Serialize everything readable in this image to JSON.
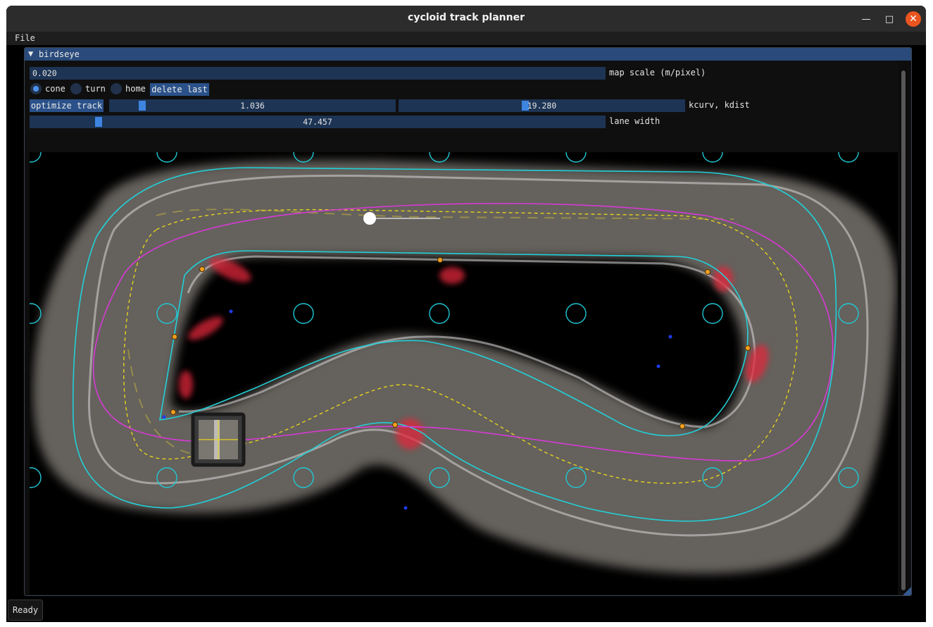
{
  "window": {
    "title": "cycloid track planner"
  },
  "menu": {
    "file": "File"
  },
  "panel": {
    "title": "birdseye",
    "collapse_icon": "triangle-down-icon"
  },
  "controls": {
    "map_scale_value": "0.020",
    "map_scale_label": "map scale (m/pixel)",
    "mode_options": [
      {
        "label": "cone",
        "selected": true
      },
      {
        "label": "turn",
        "selected": false
      },
      {
        "label": "home",
        "selected": false
      }
    ],
    "delete_last_label": "delete last",
    "optimize_label": "optimize track",
    "kcurv_value": "1.036",
    "kdist_value": "19.280",
    "kcurv_kdist_label": "kcurv, kdist",
    "lane_width_value": "47.457",
    "lane_width_label": "lane width"
  },
  "colors": {
    "accent": "#3d85e0",
    "field_bg": "#1d3454",
    "header_bg": "#294a7a",
    "boundary": "#22d0d8",
    "raceline": "#d63ad6",
    "centerline": "#e0d020",
    "cone": "#f0a020",
    "close_button": "#e95420"
  },
  "status": {
    "text": "Ready"
  }
}
